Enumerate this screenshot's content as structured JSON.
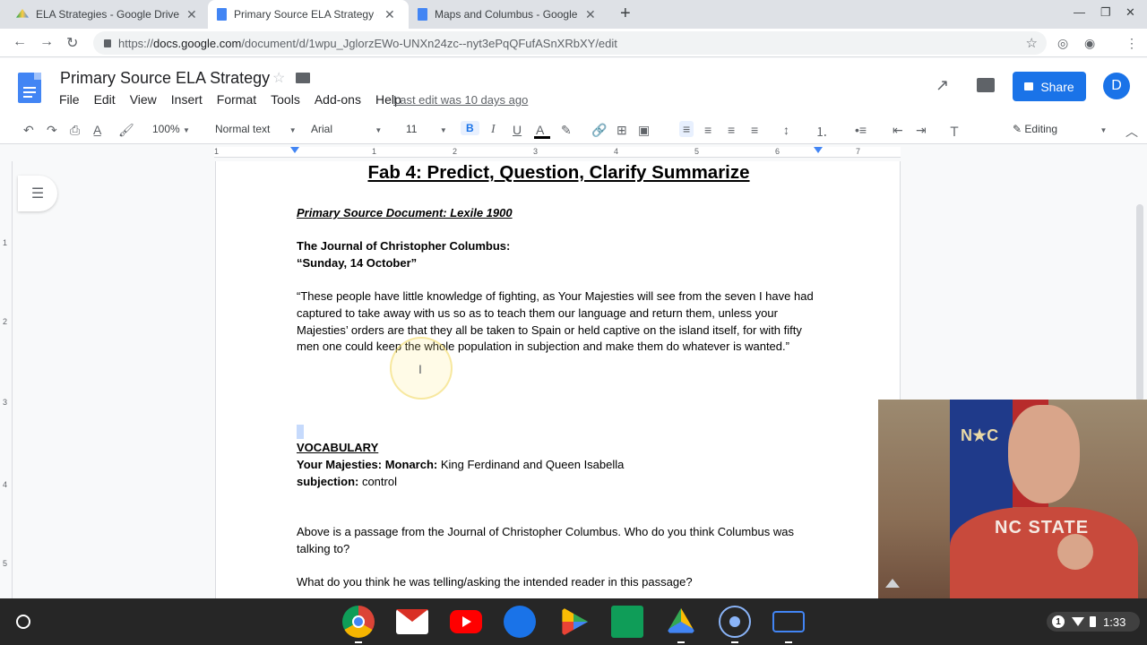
{
  "browser": {
    "tabs": [
      {
        "title": "ELA Strategies - Google Drive",
        "close": "✕",
        "active": false
      },
      {
        "title": "Primary Source ELA Strategy - G",
        "close": "✕",
        "active": true
      },
      {
        "title": "Maps and Columbus - Google D",
        "close": "✕",
        "active": false
      }
    ],
    "new_tab": "+",
    "url_prefix": "https://",
    "url_host": "docs.google.com",
    "url_path": "/document/d/1wpu_JglorzEWo-UNXn24zc--nyt3ePqQFufASnXRbXY/edit"
  },
  "docs": {
    "title": "Primary Source ELA Strategy",
    "menu": [
      "File",
      "Edit",
      "View",
      "Insert",
      "Format",
      "Tools",
      "Add-ons",
      "Help"
    ],
    "last_edit": "Last edit was 10 days ago",
    "share_label": "Share",
    "avatar_letter": "D"
  },
  "format_toolbar": {
    "zoom": "100%",
    "style": "Normal text",
    "font": "Arial",
    "size": "11",
    "bold": "B",
    "italic": "I",
    "underline": "U",
    "text_color": "A",
    "mode": "Editing"
  },
  "ruler": {
    "numbers": [
      "1",
      "1",
      "2",
      "3",
      "4",
      "5",
      "6",
      "7"
    ]
  },
  "vruler": {
    "numbers": [
      "1",
      "2",
      "3",
      "4",
      "5"
    ]
  },
  "document": {
    "heading": "Fab 4: Predict, Question, Clarify Summarize",
    "source_label": "Primary Source Document: Lexile 1900",
    "journal_title": "The Journal of Christopher Columbus:",
    "journal_date": "“Sunday, 14 October”",
    "quote": "“These people have little knowledge of fighting, as Your Majesties will see from the seven I have had captured to take away with us so as to teach them our language and return them, unless your Majesties’ orders are that they all be taken to Spain or held captive on the island itself, for with fifty men one could keep the whole population in subjection and make them do whatever is wanted.”",
    "vocab_heading": "VOCABULARY",
    "vocab": [
      {
        "term": "Your Majesties: Monarch:",
        "definition": "  King Ferdinand and Queen Isabella"
      },
      {
        "term": "subjection:",
        "definition": " control"
      }
    ],
    "question1": "Above is a passage from the Journal of Christopher Columbus. Who do you think Columbus was talking to?",
    "question2": "What do you think he was telling/asking the intended reader in this passage?"
  },
  "webcam": {
    "flag_text": "N★C",
    "shirt_text": "NC STATE"
  },
  "shelf": {
    "notification_count": "1",
    "time": "1:33"
  },
  "colors": {
    "accent": "#1a73e8",
    "tabstrip": "#dee1e6",
    "shelf": "#262626"
  }
}
